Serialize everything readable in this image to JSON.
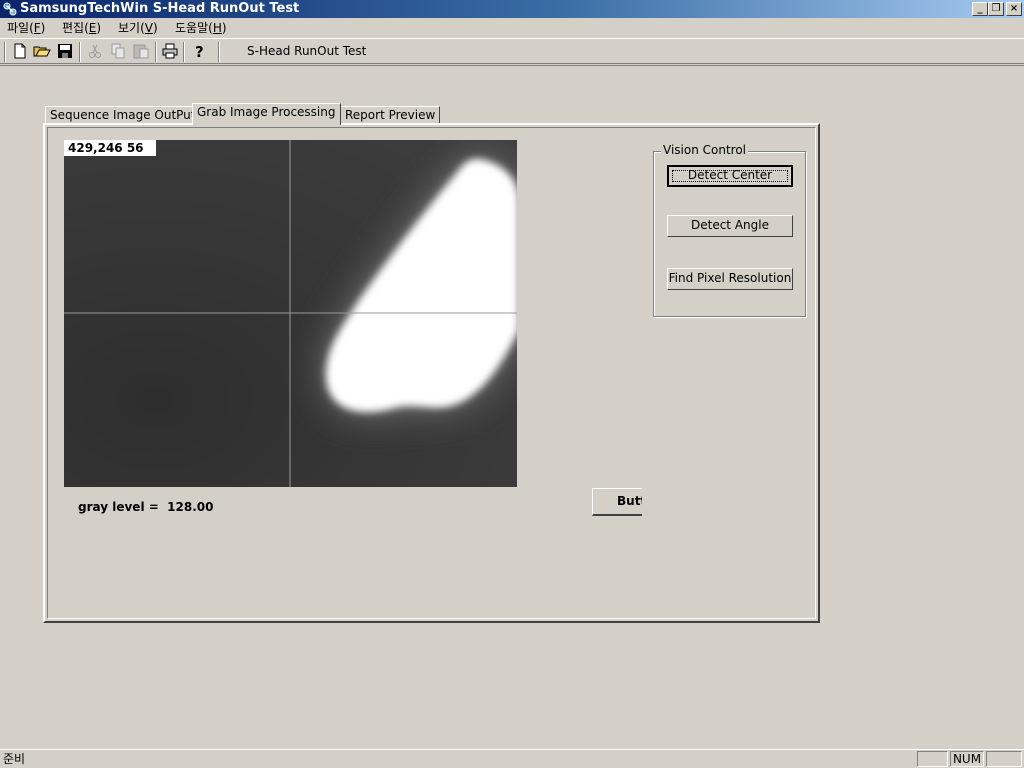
{
  "window": {
    "title": "SamsungTechWin S-Head RunOut Test",
    "controls": {
      "minimize": "_",
      "restore": "❐",
      "close": "×"
    }
  },
  "menu": {
    "items": [
      {
        "label": "파일(",
        "key": "F",
        "tail": ")"
      },
      {
        "label": "편집(",
        "key": "E",
        "tail": ")"
      },
      {
        "label": "보기(",
        "key": "V",
        "tail": ")"
      },
      {
        "label": "도움말(",
        "key": "H",
        "tail": ")"
      }
    ]
  },
  "toolbar": {
    "caption": "S-Head RunOut Test",
    "icons": [
      "new-icon",
      "open-icon",
      "save-icon",
      "cut-icon",
      "copy-icon",
      "paste-icon",
      "print-icon",
      "help-icon"
    ]
  },
  "tabs": [
    {
      "label": "Sequence Image OutPut",
      "active": false
    },
    {
      "label": "Grab Image Processing",
      "active": true
    },
    {
      "label": "Report Preview",
      "active": false
    }
  ],
  "viewer": {
    "readout": "429,246 56"
  },
  "gray_level": {
    "label": "gray level =",
    "value": "128.00"
  },
  "partial_button": {
    "label": "Butt"
  },
  "vision_control": {
    "title": "Vision Control",
    "buttons": [
      {
        "label": "Detect Center",
        "default": true
      },
      {
        "label": "Detect Angle",
        "default": false
      },
      {
        "label": "Find Pixel Resolution",
        "default": false
      }
    ]
  },
  "statusbar": {
    "text": "준비",
    "indicators": [
      "",
      "NUM",
      ""
    ]
  }
}
